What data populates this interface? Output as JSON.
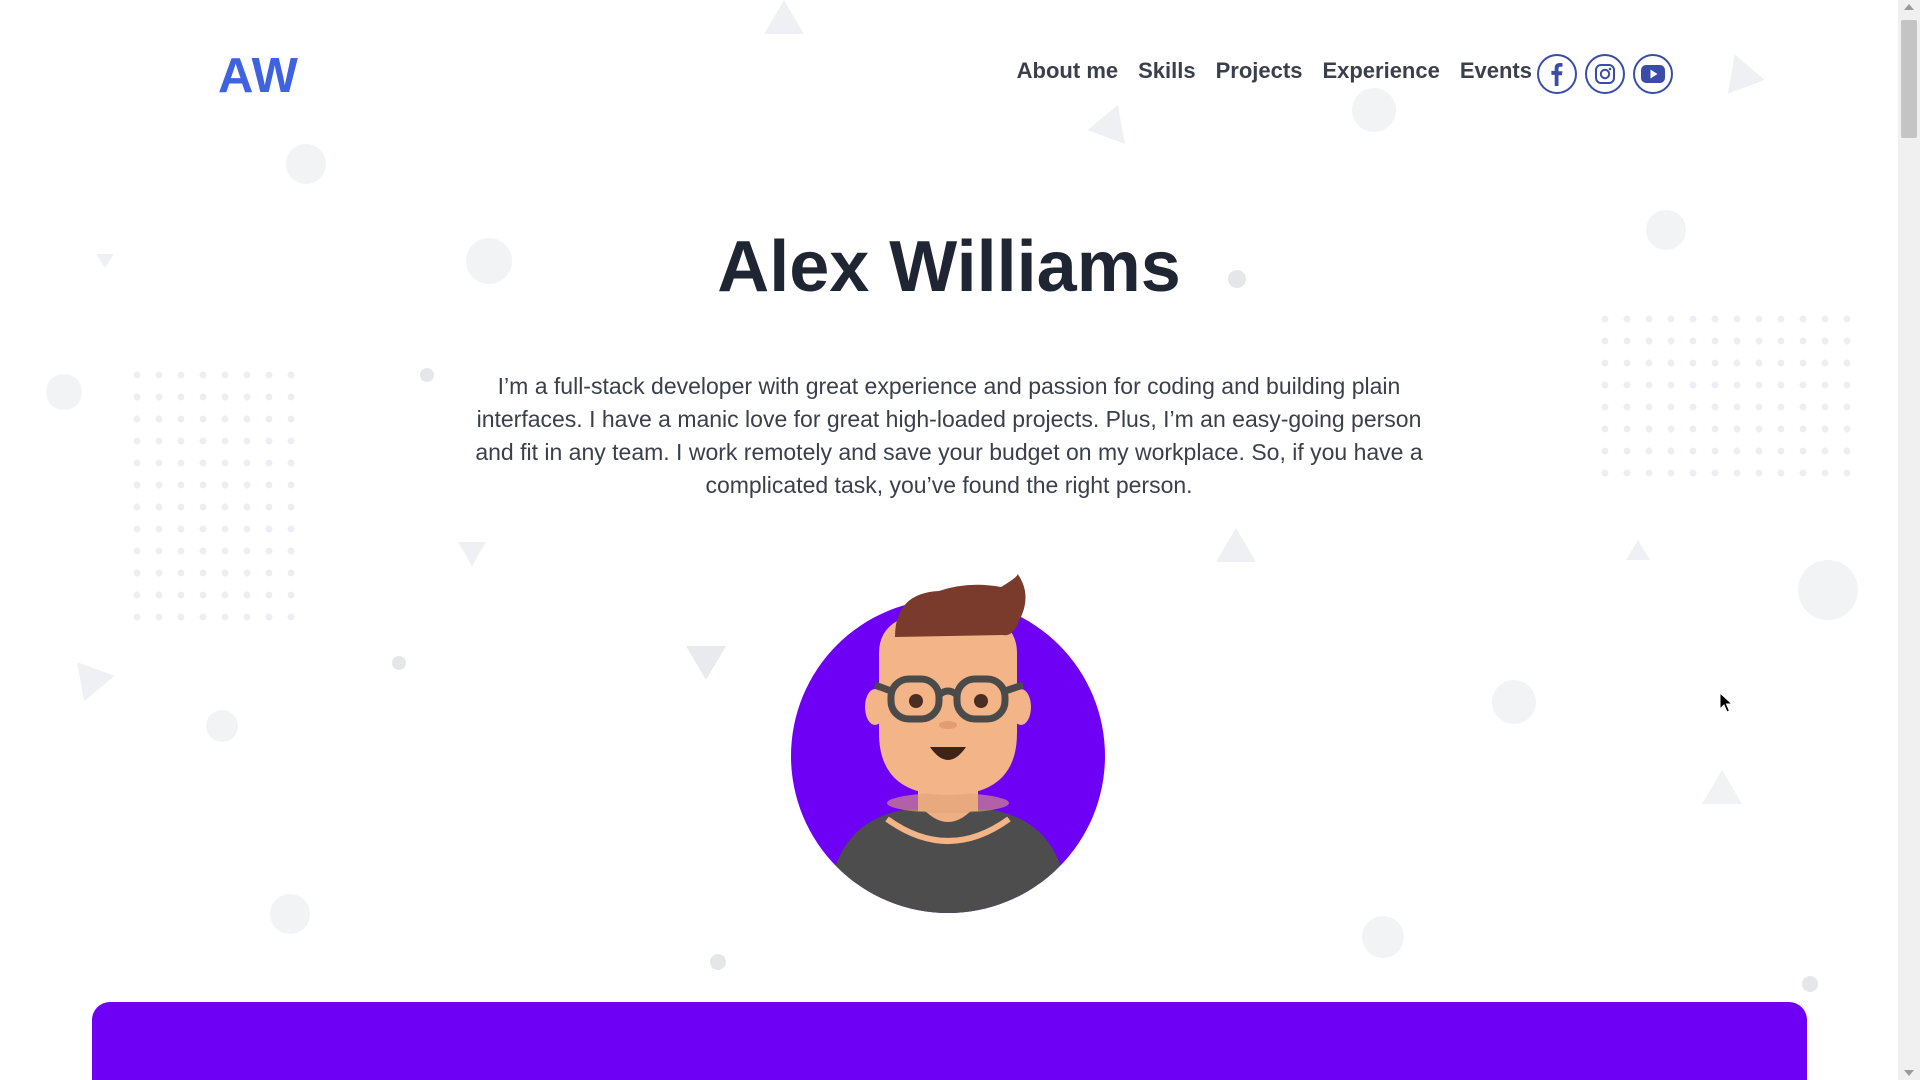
{
  "header": {
    "logo": "AW",
    "nav": [
      "About me",
      "Skills",
      "Projects",
      "Experience",
      "Events"
    ],
    "socials": [
      "facebook-icon",
      "instagram-icon",
      "youtube-icon"
    ]
  },
  "hero": {
    "name": "Alex Williams",
    "description": "I’m a full-stack developer with great experience and passion for coding and building plain interfaces. I have a manic love for great high-loaded projects. Plus, I’m an easy-going person and fit in any team. I work remotely and save your budget on my workplace. So, if you have a complicated task, you’ve found the right person.",
    "avatar": "developer-avatar-icon"
  },
  "colors": {
    "accent": "#3f63e0",
    "purple": "#6e00f5",
    "text": "#1f2533",
    "icon_border": "#3a4ca8"
  }
}
